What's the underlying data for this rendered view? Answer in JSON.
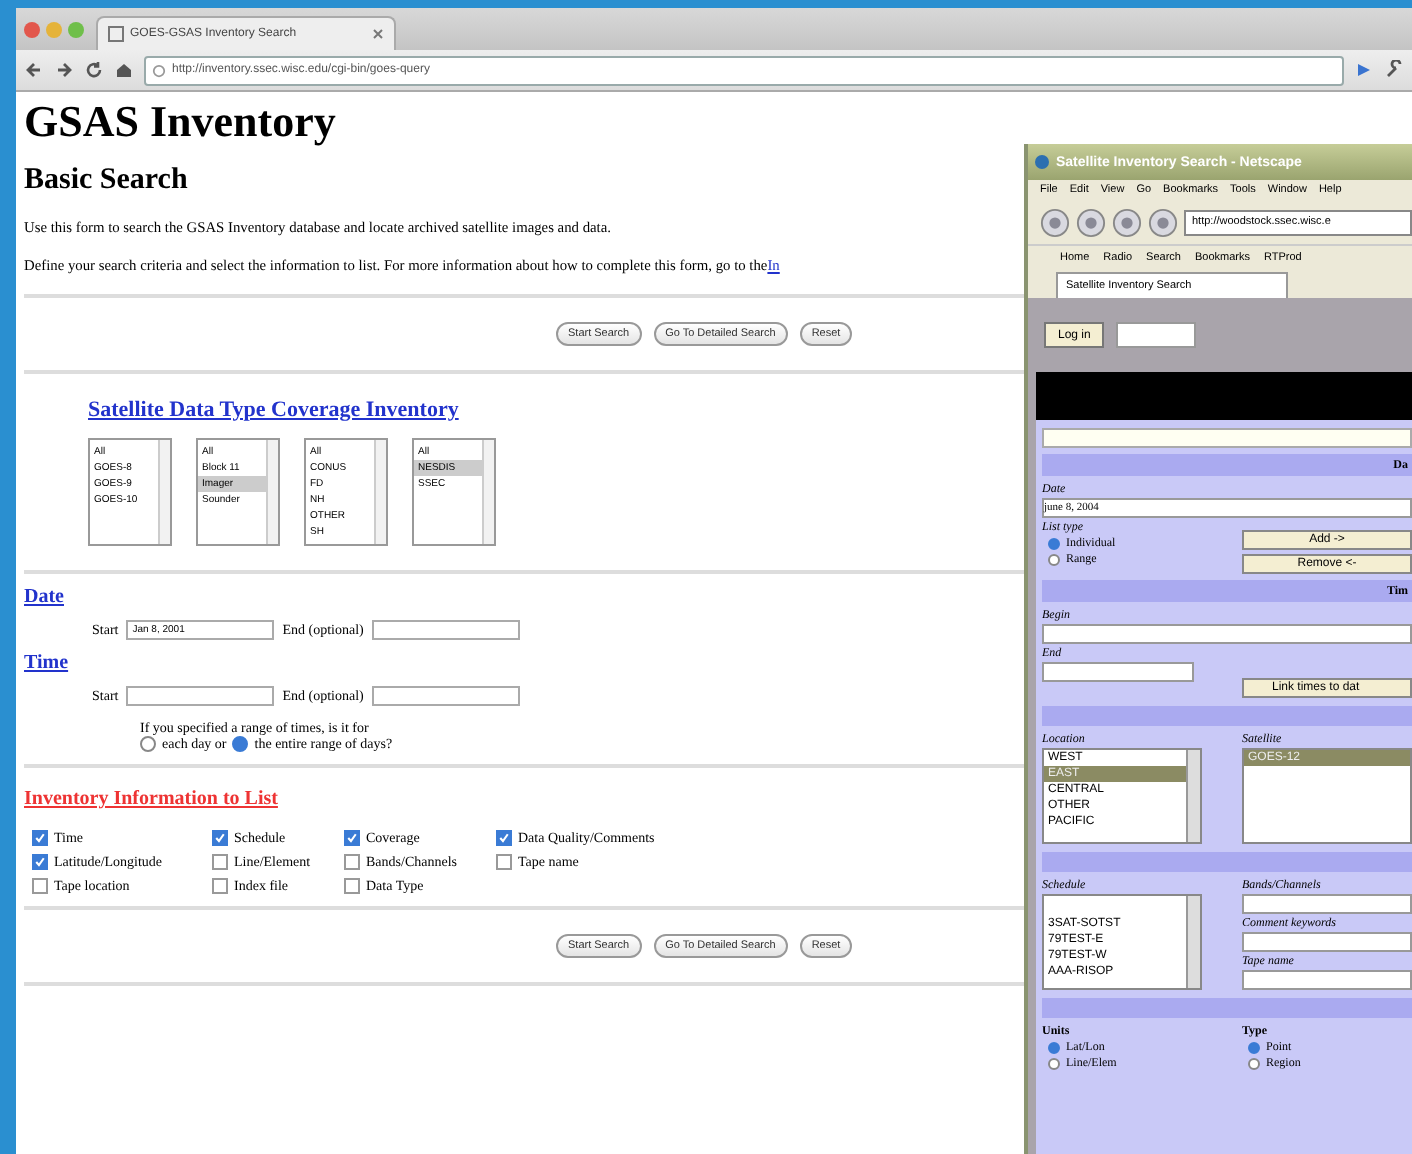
{
  "browser": {
    "tab_title": "GOES-GSAS Inventory Search",
    "url": "http://inventory.ssec.wisc.edu/cgi-bin/goes-query"
  },
  "page": {
    "title": "GSAS Inventory",
    "subtitle": "Basic Search",
    "intro": "Use this form to search the GSAS Inventory database and locate archived satellite images and data.",
    "instructions": "Define your search criteria and select the information to list. For more information about how to complete this form, go to the",
    "instructions_link": "In",
    "buttons": [
      "Start Search",
      "Go To Detailed Search",
      "Reset"
    ],
    "coverage_link": "Satellite Data Type Coverage Inventory",
    "listboxes": [
      {
        "options": [
          {
            "label": "All",
            "selected": false
          },
          {
            "label": "GOES-8",
            "selected": false
          },
          {
            "label": "GOES-9",
            "selected": false
          },
          {
            "label": "GOES-10",
            "selected": false
          }
        ]
      },
      {
        "options": [
          {
            "label": "All",
            "selected": false
          },
          {
            "label": "Block 11",
            "selected": false
          },
          {
            "label": "Imager",
            "selected": true
          },
          {
            "label": "Sounder",
            "selected": false
          }
        ]
      },
      {
        "options": [
          {
            "label": "All",
            "selected": false
          },
          {
            "label": "CONUS",
            "selected": false
          },
          {
            "label": "FD",
            "selected": false
          },
          {
            "label": "NH",
            "selected": false
          },
          {
            "label": "OTHER",
            "selected": false
          },
          {
            "label": "SH",
            "selected": false
          }
        ]
      },
      {
        "options": [
          {
            "label": "All",
            "selected": false
          },
          {
            "label": "NESDIS",
            "selected": true
          },
          {
            "label": "SSEC",
            "selected": false
          }
        ]
      }
    ],
    "date": {
      "heading": "Date",
      "start_label": "Start",
      "start_value": "Jan 8, 2001",
      "end_label": "End (optional)"
    },
    "time": {
      "heading": "Time",
      "start_label": "Start",
      "end_label": "End (optional)",
      "question": "If you specified a range of times, is it for",
      "options": [
        {
          "label": "each day or",
          "selected": false
        },
        {
          "label": "the entire range of days?",
          "selected": true
        }
      ]
    },
    "list_heading": "Inventory Information to List",
    "fields": [
      {
        "label": "Time",
        "checked": true
      },
      {
        "label": "Schedule",
        "checked": true
      },
      {
        "label": "Coverage",
        "checked": true
      },
      {
        "label": "Data Quality/Comments",
        "checked": true
      },
      {
        "label": "Latitude/Longitude",
        "checked": true
      },
      {
        "label": "Line/Element",
        "checked": false
      },
      {
        "label": "Bands/Channels",
        "checked": false
      },
      {
        "label": "Tape name",
        "checked": false
      },
      {
        "label": "Tape location",
        "checked": false
      },
      {
        "label": "Index file",
        "checked": false
      },
      {
        "label": "Data Type",
        "checked": false
      }
    ],
    "bottom_buttons": [
      "Start Search",
      "Go To Detailed Search",
      "Reset"
    ]
  },
  "netscape": {
    "title": "Satellite Inventory Search - Netscape",
    "menus": [
      "File",
      "Edit",
      "View",
      "Go",
      "Bookmarks",
      "Tools",
      "Window",
      "Help"
    ],
    "url": "http://woodstock.ssec.wisc.e",
    "bookmarks": [
      "Home",
      "Radio",
      "Search",
      "Bookmarks",
      "RTProd"
    ],
    "tab": "Satellite Inventory Search",
    "login_button": "Log in",
    "date_section": "Da",
    "date_label": "Date",
    "date_value": "june 8, 2004",
    "list_type_label": "List type",
    "list_type": [
      {
        "label": "Individual",
        "selected": true
      },
      {
        "label": "Range",
        "selected": false
      }
    ],
    "add_button": "Add ->",
    "remove_button": "Remove <-",
    "time_section": "Tim",
    "begin_label": "Begin",
    "end_label": "End",
    "link_button": "Link times to dat",
    "location_label": "Location",
    "locations": [
      {
        "label": "WEST",
        "selected": false
      },
      {
        "label": "EAST",
        "selected": true
      },
      {
        "label": "CENTRAL",
        "selected": false
      },
      {
        "label": "OTHER",
        "selected": false
      },
      {
        "label": "PACIFIC",
        "selected": false
      }
    ],
    "satellite_label": "Satellite",
    "satellites": [
      {
        "label": "GOES-12",
        "selected": true
      }
    ],
    "schedule_label": "Schedule",
    "schedules": [
      {
        "label": "3SAT-SOTST",
        "selected": false
      },
      {
        "label": "79TEST-E",
        "selected": false
      },
      {
        "label": "79TEST-W",
        "selected": false
      },
      {
        "label": "AAA-RISOP",
        "selected": false
      }
    ],
    "bands_label": "Bands/Channels",
    "comment_label": "Comment keywords",
    "tape_label": "Tape name",
    "units_label": "Units",
    "units": [
      {
        "label": "Lat/Lon",
        "selected": true
      },
      {
        "label": "Line/Elem",
        "selected": false
      }
    ],
    "type_label": "Type",
    "types": [
      {
        "label": "Point",
        "selected": true
      },
      {
        "label": "Region",
        "selected": false
      }
    ]
  }
}
